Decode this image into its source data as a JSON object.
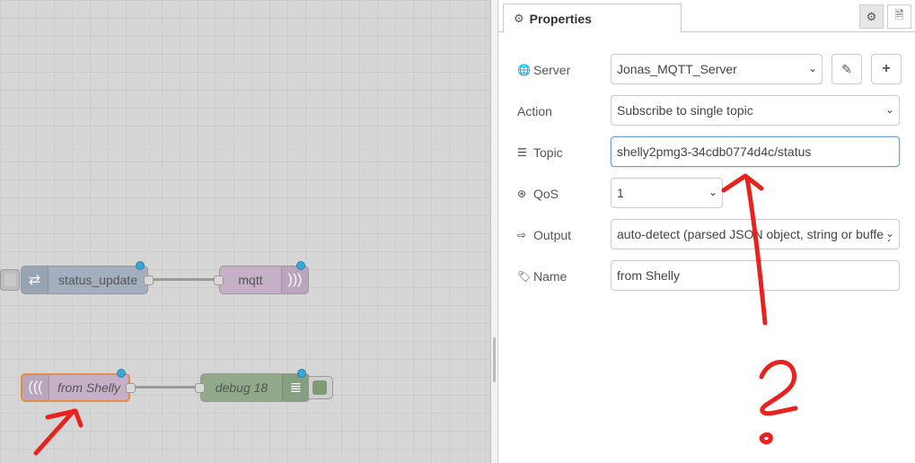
{
  "workspace": {
    "nodes": [
      {
        "id": "status_update",
        "label": "status_update"
      },
      {
        "id": "mqtt",
        "label": "mqtt"
      },
      {
        "id": "from_shelly",
        "label": "from Shelly"
      },
      {
        "id": "debug",
        "label": "debug 18"
      }
    ]
  },
  "panel": {
    "tab_title": "Properties",
    "fields": {
      "server": {
        "label": "Server",
        "value": "Jonas_MQTT_Server"
      },
      "action": {
        "label": "Action",
        "value": "Subscribe to single topic"
      },
      "topic": {
        "label": "Topic",
        "value": "shelly2pmg3-34cdb0774d4c/status"
      },
      "qos": {
        "label": "QoS",
        "value": "1"
      },
      "output": {
        "label": "Output",
        "value": "auto-detect (parsed JSON object, string or buffer)"
      },
      "name": {
        "label": "Name",
        "value": "from Shelly"
      }
    }
  },
  "annotation": {
    "question_mark": "?"
  },
  "colors": {
    "accent_dot": "#3aa7d7",
    "selected_node_border": "#e28e49",
    "annotation_red": "#e8231f"
  }
}
